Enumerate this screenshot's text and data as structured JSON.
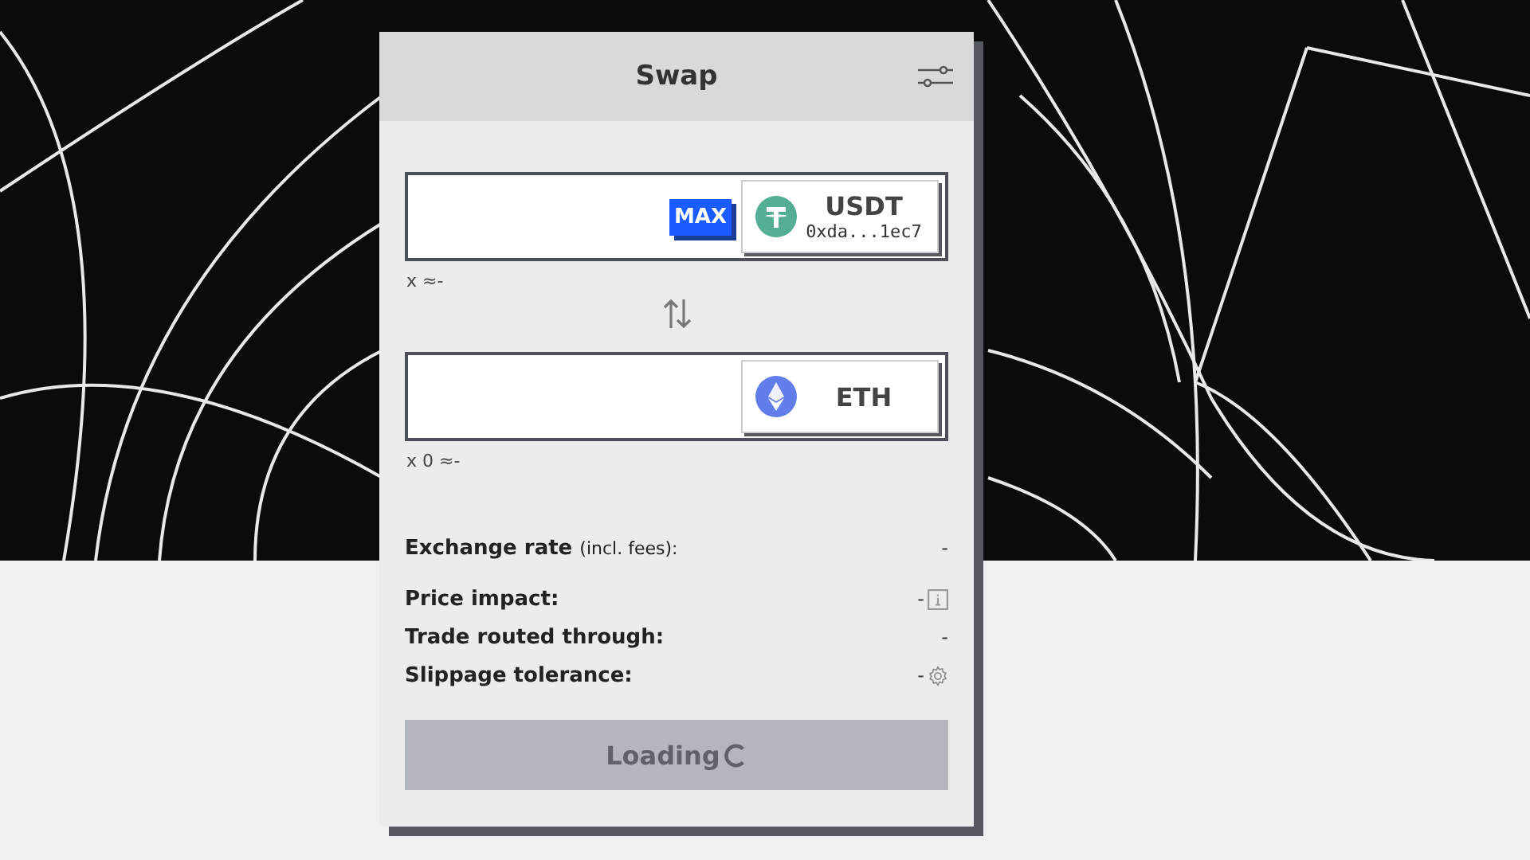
{
  "title": "Swap",
  "from": {
    "max_label": "MAX",
    "token": {
      "kind": "tether",
      "symbol": "USDT",
      "address": "0xda...1ec7"
    },
    "balance": "x ≈-"
  },
  "to": {
    "token": {
      "kind": "ether",
      "symbol": "ETH"
    },
    "balance": "x 0 ≈-"
  },
  "details": [
    {
      "label": "Exchange rate",
      "note": "(incl. fees):",
      "value": "-",
      "kind": "plain"
    },
    {
      "label": "Price impact:",
      "value": "-",
      "kind": "info"
    },
    {
      "label": "Trade routed through:",
      "value": "-",
      "kind": "plain"
    },
    {
      "label": "Slippage tolerance:",
      "value": "-",
      "kind": "settings"
    }
  ],
  "submit": {
    "label": "Loading",
    "disabled": true,
    "loading": true
  }
}
